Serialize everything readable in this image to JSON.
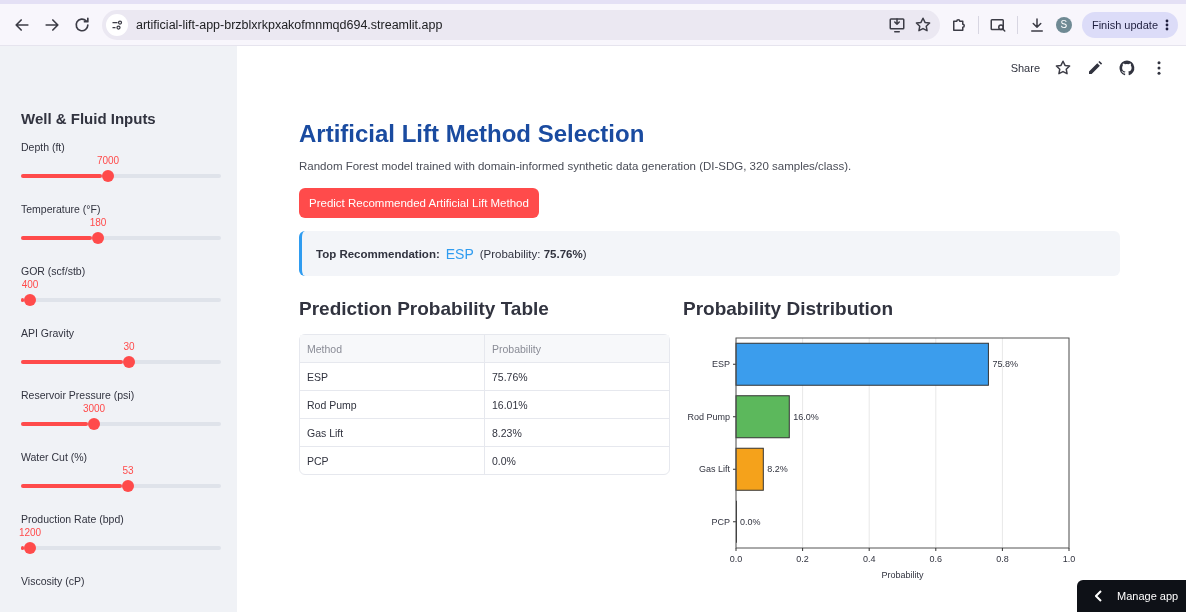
{
  "browser": {
    "url": "artificial-lift-app-brzblxrkpxakofmnmqd694.streamlit.app",
    "avatar": "S",
    "update_button": "Finish update"
  },
  "app_header": {
    "share": "Share"
  },
  "sidebar": {
    "title": "Well & Fluid Inputs",
    "sliders": [
      {
        "label": "Depth (ft)",
        "value": "7000",
        "level": 0.435
      },
      {
        "label": "Temperature (°F)",
        "value": "180",
        "level": 0.385
      },
      {
        "label": "GOR (scf/stb)",
        "value": "400",
        "level": 0.045
      },
      {
        "label": "API Gravity",
        "value": "30",
        "level": 0.54
      },
      {
        "label": "Reservoir Pressure (psi)",
        "value": "3000",
        "level": 0.365
      },
      {
        "label": "Water Cut (%)",
        "value": "53",
        "level": 0.535
      },
      {
        "label": "Production Rate (bpd)",
        "value": "1200",
        "level": 0.045
      }
    ],
    "next_label": "Viscosity (cP)"
  },
  "main": {
    "title": "Artificial Lift Method Selection",
    "subtitle": "Random Forest model trained with domain-informed synthetic data generation (DI-SDG, 320 samples/class).",
    "predict_button": "Predict Recommended Artificial Lift Method",
    "recommendation": {
      "label": "Top Recommendation:",
      "value": "ESP",
      "detail": "(Probability: **75.76%**)"
    },
    "table": {
      "title": "Prediction Probability Table",
      "columns": [
        "Method",
        "Probability"
      ],
      "rows": [
        [
          "ESP",
          "75.76%"
        ],
        [
          "Rod Pump",
          "16.01%"
        ],
        [
          "Gas Lift",
          "8.23%"
        ],
        [
          "PCP",
          "0.0%"
        ]
      ]
    },
    "chart": {
      "title": "Probability Distribution",
      "chart_data": {
        "type": "bar",
        "orientation": "horizontal",
        "xlabel": "Probability",
        "categories": [
          "ESP",
          "Rod Pump",
          "Gas Lift",
          "PCP"
        ],
        "values": [
          0.758,
          0.16,
          0.082,
          0.0
        ],
        "colors": [
          "#3b9ded",
          "#5cb85c",
          "#f5a21b",
          "#333333"
        ],
        "grid": true,
        "xlim": [
          0,
          1
        ],
        "xticks": [
          {
            "value": 0,
            "label": "0.0"
          },
          {
            "value": 0.2,
            "label": "0.2"
          },
          {
            "value": 0.4,
            "label": "0.4"
          },
          {
            "value": 0.6,
            "label": "0.6"
          },
          {
            "value": 0.8,
            "label": "0.8"
          },
          {
            "value": 1,
            "label": "1.0"
          }
        ],
        "value_labels": [
          "75.8%",
          "16.0%",
          "8.2%",
          "0.0%"
        ]
      }
    }
  },
  "manage_button": "Manage app"
}
